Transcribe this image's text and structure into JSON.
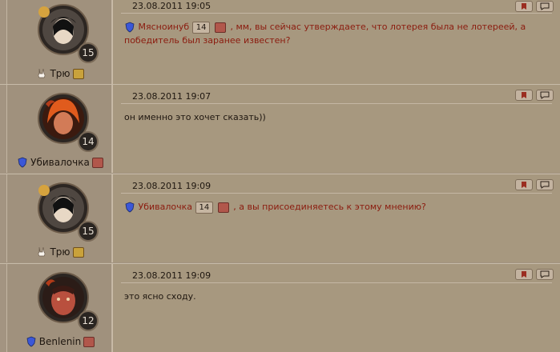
{
  "posts": [
    {
      "date": "23.08.2011 19:05",
      "author": "Трю",
      "author_level": "15",
      "text_mention": "Мясноинуб",
      "text_mention_level": "14",
      "text_parts": [
        ", мм, вы сейчас утверждаете, что лотерея была не лотереей, а",
        "победитель был заранее известен?"
      ],
      "colors": {
        "text": "#8b1b0e"
      }
    },
    {
      "date": "23.08.2011 19:07",
      "author": "Убивалочка",
      "author_level": "14",
      "text": "он именно это хочет сказать))"
    },
    {
      "date": "23.08.2011 19:09",
      "author": "Трю",
      "author_level": "15",
      "text_mention": "Убивалочка",
      "text_mention_level": "14",
      "text_parts": [
        ", а вы присоединяетесь к этому мнению?"
      ],
      "colors": {
        "text": "#8b1b0e"
      }
    },
    {
      "date": "23.08.2011 19:09",
      "author": "Benlenin",
      "author_level": "12",
      "text": "это ясно сходу."
    }
  ],
  "icons": {
    "bookmark": "bookmark-icon",
    "reply": "speech-bubble-icon",
    "inspect": "magnifier-icon"
  }
}
